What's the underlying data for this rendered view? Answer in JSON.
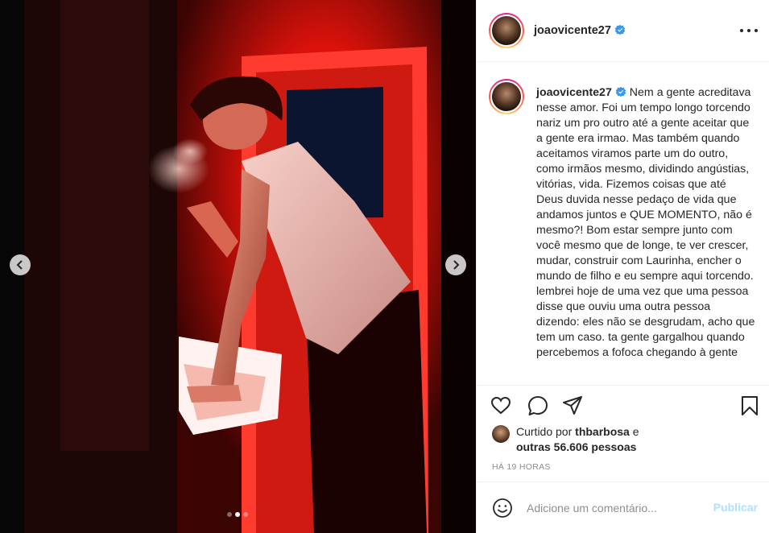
{
  "colors": {
    "accent": "#0095f6",
    "verified": "#3897f0",
    "muted": "#8e8e8e",
    "publish_disabled": "#b2dffc"
  },
  "media": {
    "carousel": {
      "slide_count": 3,
      "active_index": 1
    },
    "prev_icon": "chevron-left-icon",
    "next_icon": "chevron-right-icon"
  },
  "header": {
    "username": "joaovicente27",
    "verified_icon": "verified-badge-icon",
    "more_icon": "more-options-icon"
  },
  "caption": {
    "username": "joaovicente27",
    "text": "Nem a gente acreditava nesse amor. Foi um tempo longo torcendo nariz um pro outro até a gente aceitar que a gente era irmao. Mas também quando aceitamos viramos parte um do outro, como irmãos mesmo, dividindo angústias, vitórias, vida. Fizemos coisas que até Deus duvida nesse pedaço de vida que andamos juntos e QUE MOMENTO, não é mesmo?! Bom estar sempre junto com você mesmo que de longe, te ver crescer, mudar, construir com Laurinha, encher o mundo de filho e eu sempre aqui torcendo. lembrei hoje de uma vez que uma pessoa disse que ouviu uma outra pessoa dizendo: eles não se desgrudam, acho que tem um caso. ta gente gargalhou quando percebemos a fofoca chegando à gente"
  },
  "actions": {
    "like_icon": "heart-icon",
    "comment_icon": "comment-icon",
    "share_icon": "share-icon",
    "save_icon": "bookmark-icon"
  },
  "likes": {
    "prefix": "Curtido por ",
    "user": "thbarbosa",
    "conj": " e",
    "others": "outras 56.606 pessoas"
  },
  "timestamp": "HÁ 19 HORAS",
  "comment_box": {
    "emoji_icon": "emoji-icon",
    "placeholder": "Adicione um comentário...",
    "publish_label": "Publicar"
  }
}
